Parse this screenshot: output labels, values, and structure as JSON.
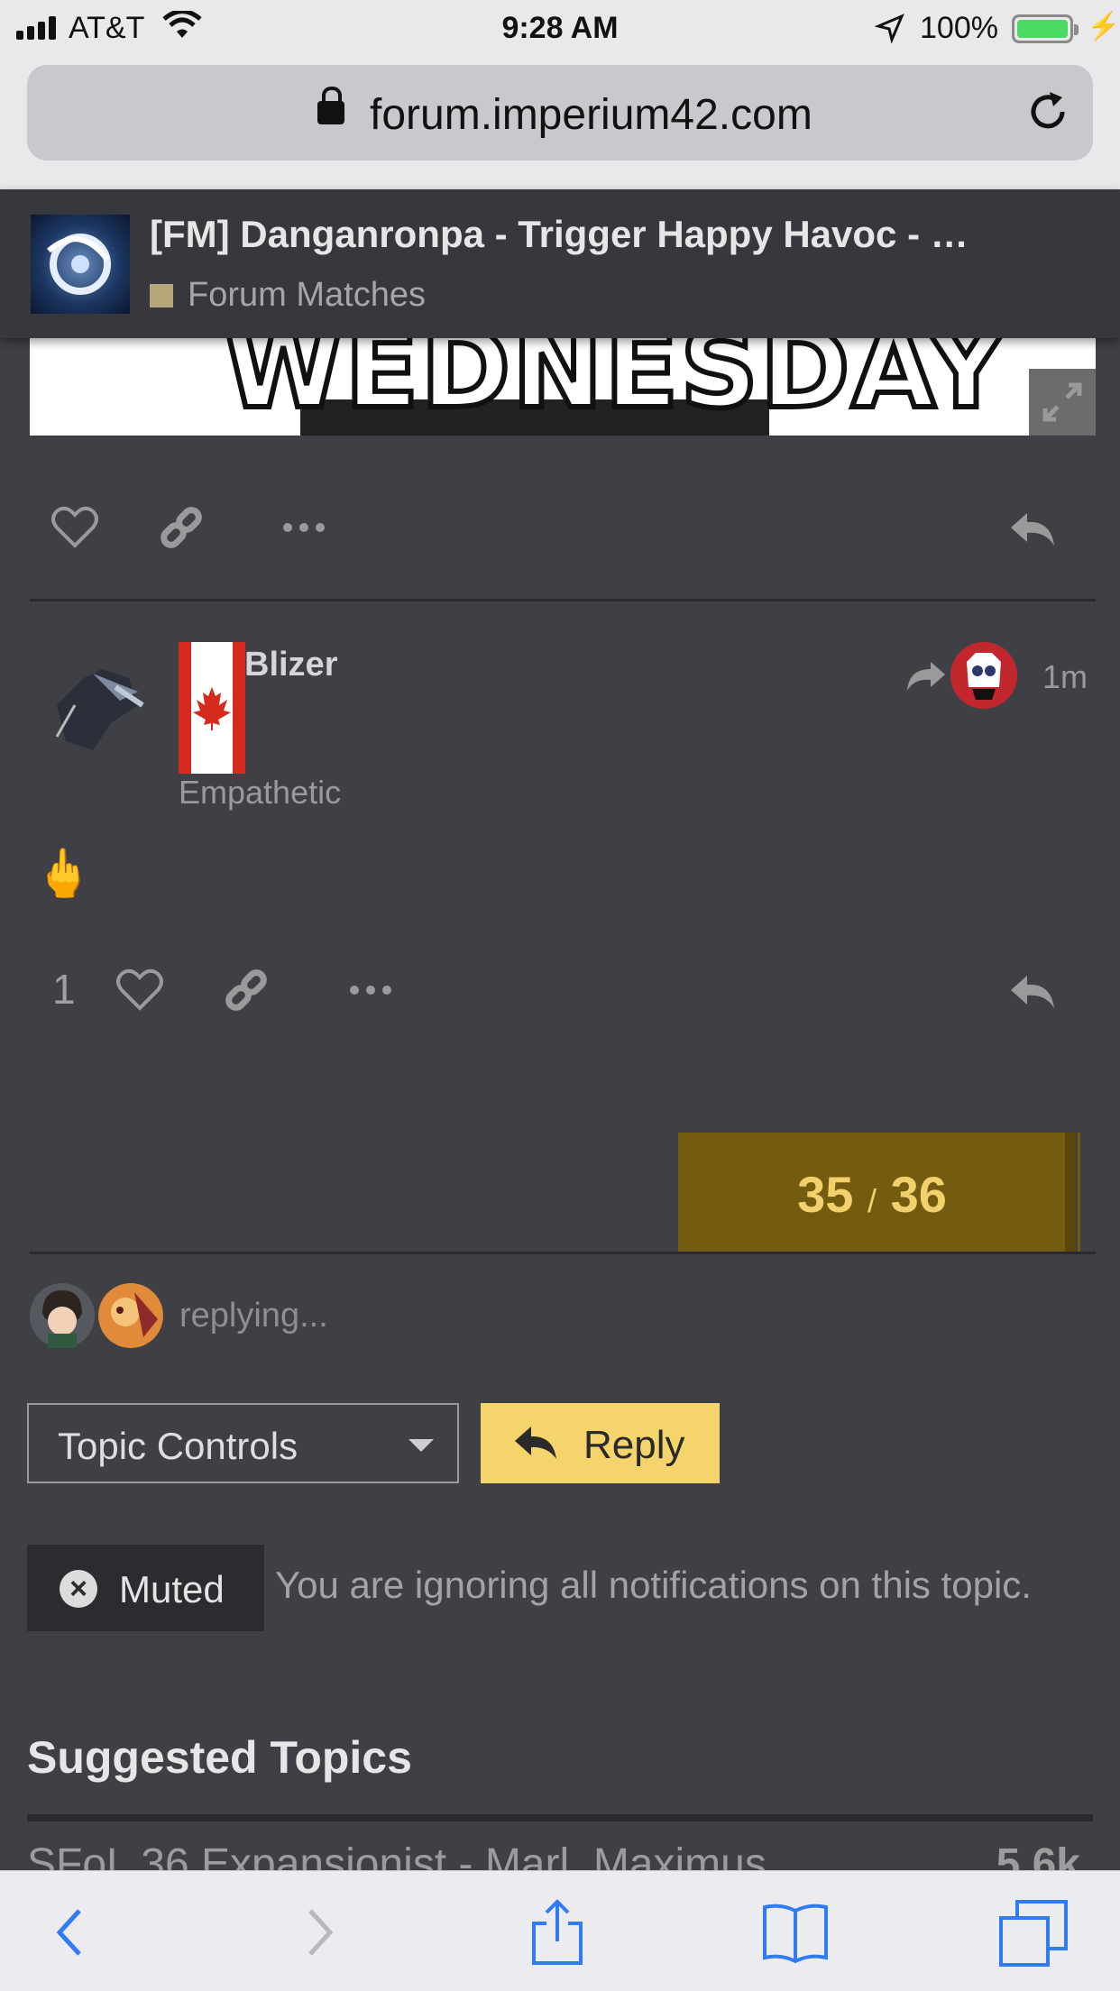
{
  "status_bar": {
    "carrier": "AT&T",
    "time": "9:28 AM",
    "battery": "100%",
    "battery_level": 1.0
  },
  "browser": {
    "url": "forum.imperium42.com"
  },
  "topic_header": {
    "title": "[FM] Danganronpa - Trigger Happy Havoc - …",
    "category": "Forum Matches",
    "category_color": "#b8a57a"
  },
  "previous_post": {
    "image_text": "WEDNESDAY"
  },
  "post": {
    "username": "Blizer",
    "user_title": "Empathetic",
    "time": "1m",
    "body": "🖕",
    "like_count": "1"
  },
  "timeline": {
    "current": "35",
    "separator": "/",
    "total": "36"
  },
  "replying": {
    "text": "replying..."
  },
  "controls": {
    "topic_controls_label": "Topic Controls",
    "reply_label": "Reply",
    "reply_color": "#f5d56b"
  },
  "notification": {
    "level_label": "Muted",
    "description": "You are ignoring all notifications on this topic."
  },
  "suggested": {
    "heading": "Suggested Topics",
    "rows": [
      {
        "title": "SFoL 36 Expansionist - Marl, Maximus",
        "views": "5.6k"
      }
    ]
  },
  "accent_colors": {
    "timeline_bg": "#735b0f",
    "timeline_text": "#f2d06b",
    "page_bg": "#3e4046"
  }
}
